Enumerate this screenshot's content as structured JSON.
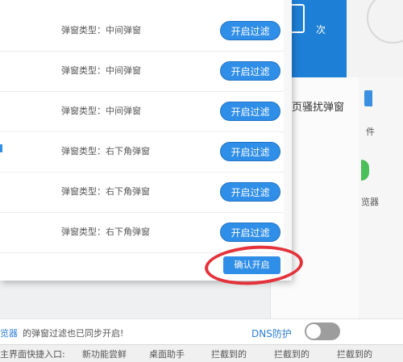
{
  "background": {
    "next_label": "次",
    "panel_title": "页骚扰弹窗",
    "side_file": "件",
    "side_browser": "览器",
    "status_prefix": "览器",
    "status_suffix": "的弹窗过滤也已同步开启!",
    "dns_label": "DNS防护",
    "bottom_items": [
      "主界面快捷入口:",
      "新功能尝鲜",
      "桌面助手",
      "拦截到的",
      "拦截到的",
      "拦截到的"
    ]
  },
  "dialog": {
    "rows": [
      {
        "type": "弹窗类型：中间弹窗",
        "button": "开启过滤"
      },
      {
        "type": "弹窗类型：中间弹窗",
        "button": "开启过滤"
      },
      {
        "type": "弹窗类型：中间弹窗",
        "button": "开启过滤"
      },
      {
        "type": "弹窗类型：右下角弹窗",
        "button": "开启过滤"
      },
      {
        "type": "弹窗类型：右下角弹窗",
        "button": "开启过滤"
      },
      {
        "type": "弹窗类型：右下角弹窗",
        "button": "开启过滤"
      }
    ],
    "confirm_label": "确认开启"
  },
  "colors": {
    "accent": "#2f8ee8",
    "annotation": "#e3323b"
  }
}
